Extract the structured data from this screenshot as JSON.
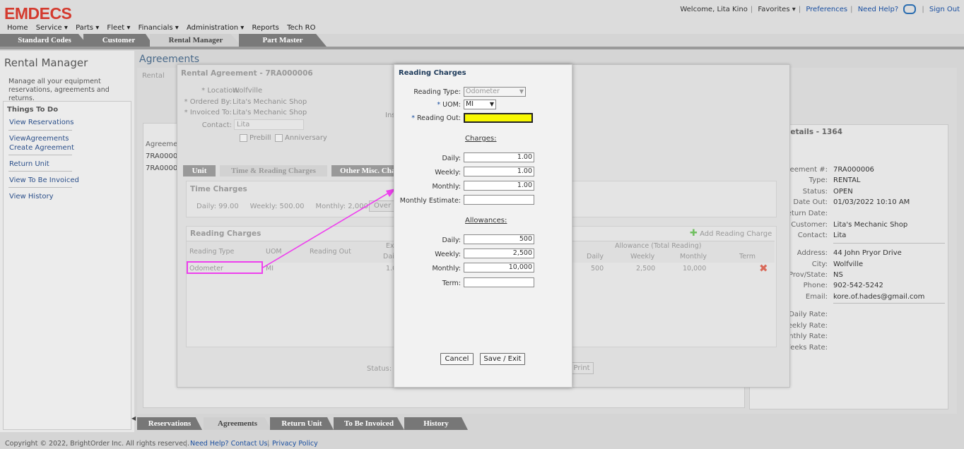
{
  "header": {
    "logo": "EMDECS",
    "welcome": "Welcome, Lita Kino",
    "links": [
      "Favorites ▾",
      "Preferences",
      "Need Help?",
      "Sign Out"
    ],
    "menu": [
      "Home",
      "Service ▾",
      "Parts ▾",
      "Fleet ▾",
      "Financials ▾",
      "Administration ▾",
      "Reports",
      "Tech RO"
    ]
  },
  "tabs": [
    "Standard Codes",
    "Customer",
    "Rental Manager",
    "Part Master"
  ],
  "left": {
    "title": "Rental Manager",
    "description": "Manage all your equipment reservations, agreements and returns.",
    "todo_title": "Things To Do",
    "items": [
      "View Reservations",
      "ViewAgreements",
      "Create Agreement",
      "Return Unit",
      "View To Be Invoiced",
      "View History"
    ]
  },
  "main": {
    "title": "Agreements",
    "list_header": "Agreemen",
    "rows": [
      "7RA00000",
      "7RA00000"
    ]
  },
  "agreement": {
    "title": "Rental Agreement - 7RA000006",
    "sub_tab": "Rental",
    "location_label": "* Location:",
    "location": "Wolfville",
    "ordered_label": "* Ordered By:",
    "ordered": "Lita's Mechanic Shop",
    "invoiced_label": "* Invoiced To:",
    "invoiced": "Lita's Mechanic Shop",
    "contact_label": "Contact:",
    "contact": "Lita",
    "prebill": "Prebill",
    "anniversary": "Anniversary",
    "ins_label": "Ins",
    "tabs": [
      "Unit",
      "Time & Reading Charges",
      "Other Misc. Cha"
    ],
    "time_charges_title": "Time Charges",
    "time_charges_line": "Daily: 99.00     Weekly: 500.00     Monthly: 2,000.00",
    "over_btn": "Over",
    "reading_charges_title": "Reading Charges",
    "add_reading": "Add Reading Charge",
    "col_headers": [
      "Reading Type",
      "UOM",
      "Reading Out",
      "Ex",
      "Dai"
    ],
    "allowance_header": "Allowance (Total Reading)",
    "allowance_cols": [
      "Daily",
      "Weekly",
      "Monthly",
      "Term"
    ],
    "row": {
      "type": "Odometer",
      "uom": "MI",
      "ex": "1.0",
      "daily": "500",
      "weekly": "2,500",
      "monthly": "10,000"
    },
    "status_label": "Status:",
    "print_btn": "Print"
  },
  "details": {
    "title": "t Details - 1364",
    "rows": [
      {
        "k": "reement #:",
        "v": "7RA000006"
      },
      {
        "k": "Type:",
        "v": "RENTAL"
      },
      {
        "k": "Status:",
        "v": "OPEN"
      },
      {
        "k": "Date Out:",
        "v": "01/03/2022 10:10 AM"
      },
      {
        "k": "Return Date:",
        "v": ""
      },
      {
        "k": "r Customer:",
        "v": "Lita's Mechanic Shop"
      },
      {
        "k": "Contact:",
        "v": "Lita"
      },
      {
        "k": "Address:",
        "v": "44 John Pryor Drive"
      },
      {
        "k": "City:",
        "v": "Wolfville"
      },
      {
        "k": "Prov/State:",
        "v": "NS"
      },
      {
        "k": "Phone:",
        "v": "902-542-5242"
      },
      {
        "k": "Email:",
        "v": "kore.of.hades@gmail.com"
      },
      {
        "k": "Daily Rate:",
        "v": ""
      },
      {
        "k": "Veekly Rate:",
        "v": ""
      },
      {
        "k": "lonthly Rate:",
        "v": ""
      },
      {
        "k": "Weeks Rate:",
        "v": ""
      }
    ]
  },
  "modal": {
    "title": "Reading Charges",
    "reading_type_label": "Reading Type:",
    "reading_type": "Odometer",
    "uom_label": "UOM:",
    "uom": "MI",
    "reading_out_label": "Reading Out:",
    "reading_out": "",
    "charges_heading": "Charges:",
    "daily_label": "Daily:",
    "weekly_label": "Weekly:",
    "monthly_label": "Monthly:",
    "monthly_estimate_label": "Monthly Estimate:",
    "charges": {
      "daily": "1.00",
      "weekly": "1.00",
      "monthly": "1.00",
      "monthly_estimate": ""
    },
    "allowances_heading": "Allowances:",
    "term_label": "Term:",
    "allowances": {
      "daily": "500",
      "weekly": "2,500",
      "monthly": "10,000",
      "term": ""
    },
    "cancel": "Cancel",
    "save": "Save / Exit"
  },
  "bottom_tabs": [
    "Reservations",
    "Agreements",
    "Return Unit",
    "To Be Invoiced",
    "History"
  ],
  "footer": {
    "copyright": "Copyright © 2022, BrightOrder Inc. All rights reserved.",
    "help": "Need Help? Contact Us.",
    "privacy": "Privacy Policy"
  },
  "colors": {
    "logo": "#d43a2e",
    "highlight": "#f7f700",
    "annotation": "#ee40ee",
    "link": "#1a4fa0"
  }
}
